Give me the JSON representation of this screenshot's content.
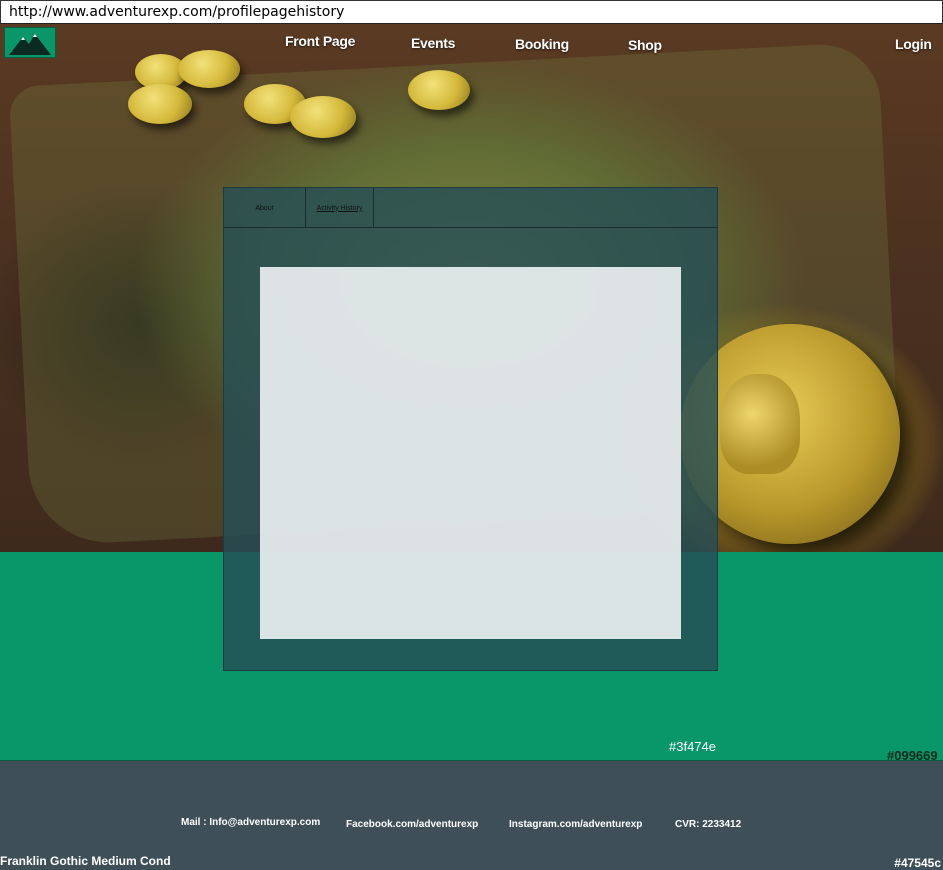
{
  "browser": {
    "url": "http://www.adventurexp.com/profilepagehistory"
  },
  "header": {
    "logo_icon": "mountain-icon",
    "nav": [
      {
        "label": "Front Page"
      },
      {
        "label": "Events"
      },
      {
        "label": "Booking"
      },
      {
        "label": "Shop"
      }
    ],
    "login_label": "Login"
  },
  "profile": {
    "tabs": [
      {
        "label": "About"
      },
      {
        "label": "Activity History",
        "active": true
      }
    ]
  },
  "annotations": {
    "panel_color": "#3f474e",
    "green_color": "#099669",
    "footer_color": "#47545c",
    "font_name": "Franklin Gothic Medium Cond"
  },
  "footer": {
    "mail": "Mail : Info@adventurexp.com",
    "facebook": "Facebook.com/adventurexp",
    "instagram": "Instagram.com/adventurexp",
    "cvr": "CVR: 2233412"
  }
}
